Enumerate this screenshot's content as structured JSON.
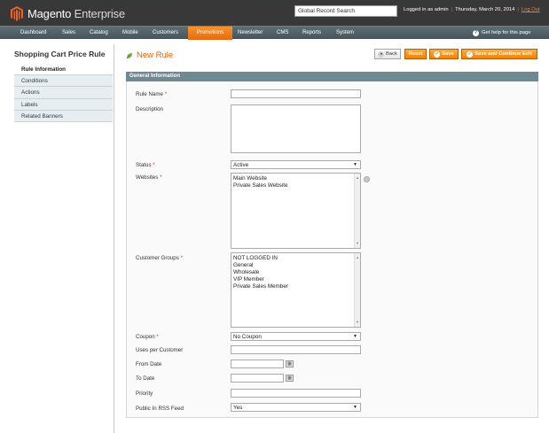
{
  "header": {
    "app_name_1": "Magento",
    "app_name_2": "Enterprise",
    "global_search_placeholder": "Global Record Search",
    "logged_in": "Logged in as admin",
    "date": "Thursday, March 20, 2014",
    "logout": "Log Out",
    "brand_color": "#f58220"
  },
  "nav": {
    "items": [
      "Dashboard",
      "Sales",
      "Catalog",
      "Mobile",
      "Customers",
      "Promotions",
      "Newsletter",
      "CMS",
      "Reports",
      "System"
    ],
    "active": "Promotions",
    "help": "Get help for this page"
  },
  "sidebar": {
    "title": "Shopping Cart Price Rule",
    "tabs": [
      "Rule Information",
      "Conditions",
      "Actions",
      "Labels",
      "Related Banners"
    ]
  },
  "page": {
    "title": "New Rule",
    "buttons": {
      "back": "Back",
      "reset": "Reset",
      "save": "Save",
      "save_continue": "Save and Continue Edit"
    }
  },
  "section": {
    "title": "General Information"
  },
  "form": {
    "rule_name": {
      "label": "Rule Name",
      "value": ""
    },
    "description": {
      "label": "Description",
      "value": ""
    },
    "status": {
      "label": "Status",
      "value": "Active"
    },
    "websites": {
      "label": "Websites",
      "options": [
        "Main Website",
        "Private Sales Website"
      ]
    },
    "customer_groups": {
      "label": "Customer Groups",
      "options": [
        "NOT LOGGED IN",
        "General",
        "Wholesale",
        "VIP Member",
        "Private Sales Member"
      ]
    },
    "coupon": {
      "label": "Coupon",
      "value": "No Coupon"
    },
    "uses_per_customer": {
      "label": "Uses per Customer",
      "value": ""
    },
    "from_date": {
      "label": "From Date",
      "value": ""
    },
    "to_date": {
      "label": "To Date",
      "value": ""
    },
    "priority": {
      "label": "Priority",
      "value": ""
    },
    "rss": {
      "label": "Public In RSS Feed",
      "value": "Yes"
    },
    "required_mark": "*"
  }
}
